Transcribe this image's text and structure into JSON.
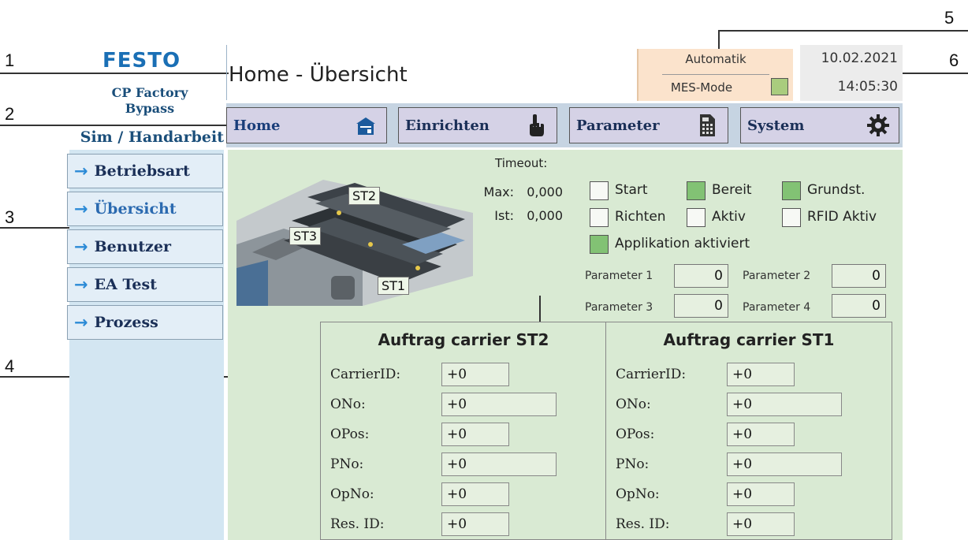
{
  "callouts": {
    "n1": "1",
    "n2": "2",
    "n3": "3",
    "n4": "4",
    "n5": "5",
    "n6": "6"
  },
  "header": {
    "logo": "FESTO",
    "station_line1": "CP Factory",
    "station_line2": "Bypass",
    "mode": "Sim / Handarbeit",
    "title": "Home - Übersicht",
    "status_top": "Automatik",
    "status_bottom": "MES-Mode",
    "date": "10.02.2021",
    "time": "14:05:30"
  },
  "nav": {
    "home": "Home",
    "einrichten": "Einrichten",
    "parameter": "Parameter",
    "system": "System"
  },
  "sidebar": {
    "items": [
      {
        "label": "Betriebsart"
      },
      {
        "label": "Übersicht"
      },
      {
        "label": "Benutzer"
      },
      {
        "label": "EA Test"
      },
      {
        "label": "Prozess"
      }
    ]
  },
  "stations": {
    "st1": "ST1",
    "st2": "ST2",
    "st3": "ST3"
  },
  "timeout": {
    "title": "Timeout:",
    "max_label": "Max:",
    "max_value": "0,000",
    "ist_label": "Ist:",
    "ist_value": "0,000"
  },
  "status_flags": {
    "start": "Start",
    "bereit": "Bereit",
    "grundst": "Grundst.",
    "richten": "Richten",
    "aktiv": "Aktiv",
    "rfid": "RFID Aktiv",
    "applikation": "Applikation aktiviert"
  },
  "parameters": {
    "p1_label": "Parameter 1",
    "p1_value": "0",
    "p2_label": "Parameter 2",
    "p2_value": "0",
    "p3_label": "Parameter 3",
    "p3_value": "0",
    "p4_label": "Parameter 4",
    "p4_value": "0"
  },
  "carrier_st2": {
    "title": "Auftrag carrier ST2",
    "carrierid_label": "CarrierID:",
    "carrierid": "+0",
    "ono_label": "ONo:",
    "ono": "+0",
    "opos_label": "OPos:",
    "opos": "+0",
    "pno_label": "PNo:",
    "pno": "+0",
    "opno_label": "OpNo:",
    "opno": "+0",
    "resid_label": "Res. ID:",
    "resid": "+0"
  },
  "carrier_st1": {
    "title": "Auftrag carrier ST1",
    "carrierid_label": "CarrierID:",
    "carrierid": "+0",
    "ono_label": "ONo:",
    "ono": "+0",
    "opos_label": "OPos:",
    "opos": "+0",
    "pno_label": "PNo:",
    "pno": "+0",
    "opno_label": "OpNo:",
    "opno": "+0",
    "resid_label": "Res. ID:",
    "resid": "+0"
  },
  "colors": {
    "accent_blue": "#1a6fb5",
    "panel_green": "#d9ead3",
    "sidebar_blue": "#d3e6f2",
    "indicator_green": "#82c274",
    "status_orange": "#fbe3cc"
  }
}
